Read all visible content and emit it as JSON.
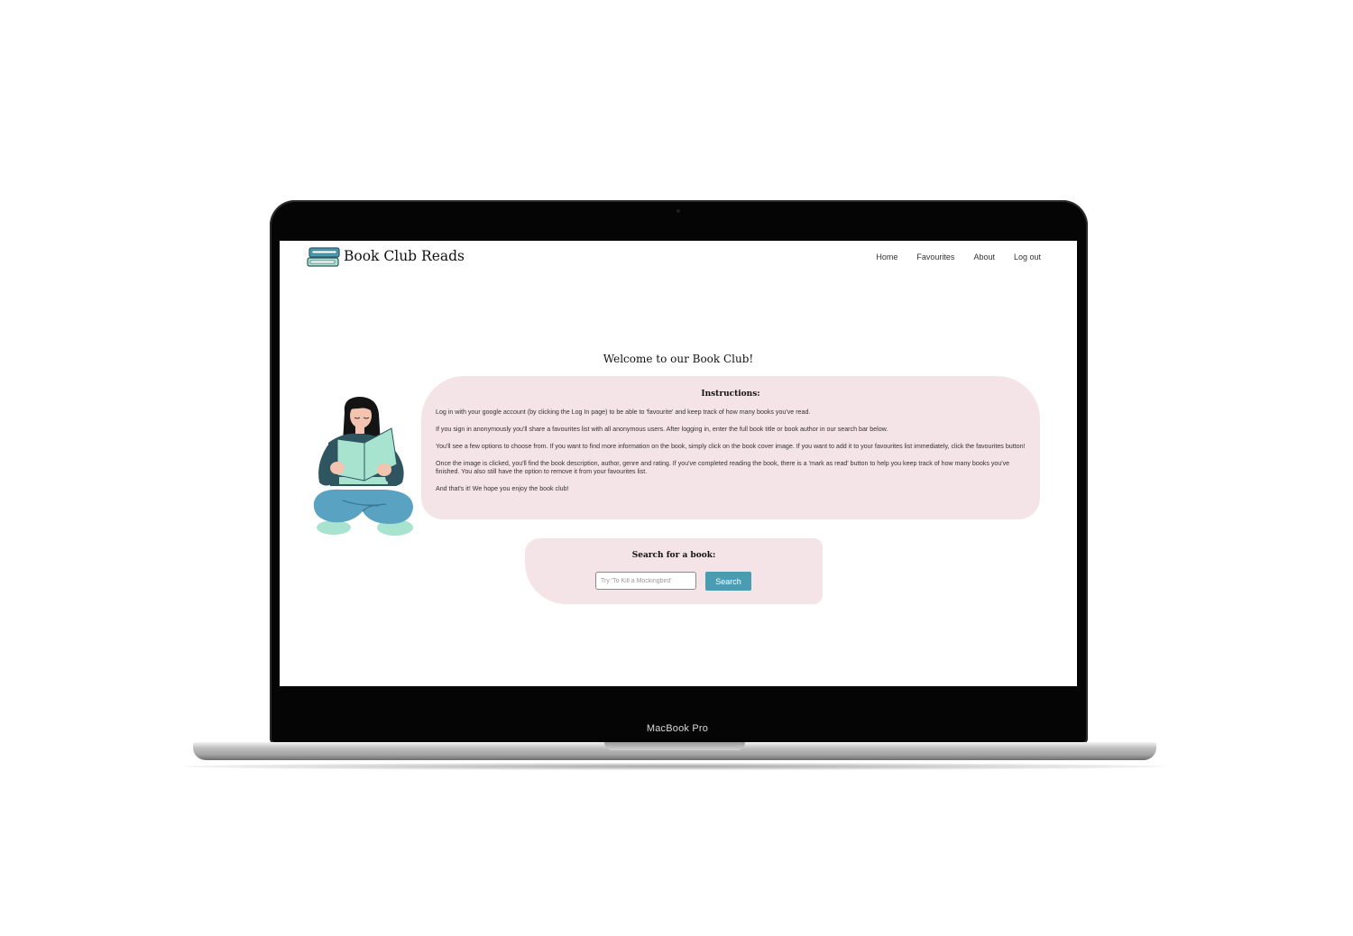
{
  "app": {
    "title": "Book Club Reads",
    "logo_icon": "book-stack-icon"
  },
  "nav": {
    "items": [
      {
        "label": "Home"
      },
      {
        "label": "Favourites"
      },
      {
        "label": "About"
      },
      {
        "label": "Log out"
      }
    ]
  },
  "main": {
    "welcome": "Welcome to our Book Club!",
    "illustration": "woman-reading-book-illustration",
    "instructions": {
      "title": "Instructions:",
      "paragraphs": [
        "Log in with your google account (by clicking the Log In page) to be able to 'favourite' and keep track of how many books you've read.",
        "If you sign in anonymously you'll share a favourites list with all anonymous users. After logging in, enter the full book title or book author in our search bar below.",
        "You'll see a few options to choose from. If you want to find more information on the book, simply click on the book cover image. If you want to add it to your favourites list immediately, click the favourites button!",
        "Once the image is clicked, you'll find the book description, author, genre and rating. If you've completed reading the book, there is a 'mark as read' button to help you keep track of how many books you've finished. You also still have the option to remove it from your favourites list.",
        "And that's it! We hope you enjoy the book club!"
      ]
    },
    "search": {
      "title": "Search for a book:",
      "placeholder": "Try 'To Kill a Mockingbird'",
      "value": "",
      "button_label": "Search"
    }
  },
  "device": {
    "label": "MacBook Pro"
  },
  "colors": {
    "card_background": "#f5e4e7",
    "accent": "#4a9cb3",
    "mint": "#a7e3cf",
    "teal_dark": "#2f5561"
  }
}
